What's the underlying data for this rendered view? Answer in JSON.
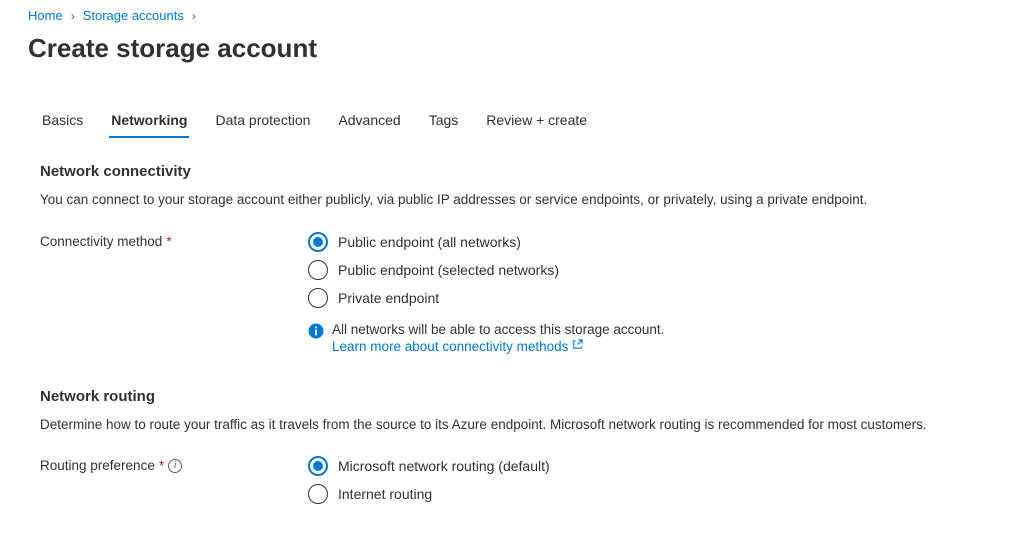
{
  "breadcrumb": {
    "home": "Home",
    "storage_accounts": "Storage accounts"
  },
  "page_title": "Create storage account",
  "tabs": {
    "basics": "Basics",
    "networking": "Networking",
    "data_protection": "Data protection",
    "advanced": "Advanced",
    "tags": "Tags",
    "review_create": "Review + create"
  },
  "connectivity": {
    "section_title": "Network connectivity",
    "section_desc": "You can connect to your storage account either publicly, via public IP addresses or service endpoints, or privately, using a private endpoint.",
    "label": "Connectivity method",
    "options": {
      "public_all": "Public endpoint (all networks)",
      "public_selected": "Public endpoint (selected networks)",
      "private": "Private endpoint"
    },
    "info_text": "All networks will be able to access this storage account.",
    "learn_link": "Learn more about connectivity methods"
  },
  "routing": {
    "section_title": "Network routing",
    "section_desc": "Determine how to route your traffic as it travels from the source to its Azure endpoint. Microsoft network routing is recommended for most customers.",
    "label": "Routing preference",
    "options": {
      "microsoft": "Microsoft network routing (default)",
      "internet": "Internet routing"
    }
  }
}
